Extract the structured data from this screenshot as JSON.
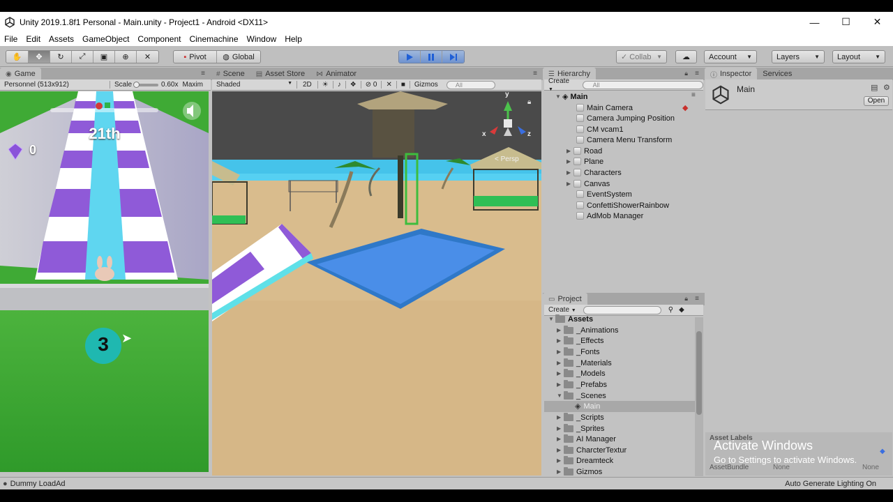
{
  "window": {
    "title": "Unity 2019.1.8f1 Personal - Main.unity - Project1 - Android <DX11>",
    "minimize": "—",
    "maximize": "☐",
    "close": "✕"
  },
  "menu": [
    "File",
    "Edit",
    "Assets",
    "GameObject",
    "Component",
    "Cinemachine",
    "Window",
    "Help"
  ],
  "toolbar": {
    "pivot": "Pivot",
    "global": "Global",
    "collab": "Collab",
    "account": "Account",
    "layers": "Layers",
    "layout": "Layout"
  },
  "game": {
    "tab": "Game",
    "resolution": "Personnel (513x912)",
    "scale_label": "Scale",
    "scale_value": "0.60x",
    "maximize": "Maxim",
    "rank": "21th",
    "gems": "0",
    "countdown": "3"
  },
  "scene": {
    "tabs": [
      "Scene",
      "Asset Store",
      "Animator"
    ],
    "shading": "Shaded",
    "mode_2d": "2D",
    "fx_count": "0",
    "gizmos": "Gizmos",
    "search_placeholder": "All",
    "persp": "< Persp",
    "axis_x": "x",
    "axis_y": "y",
    "axis_z": "z"
  },
  "hierarchy": {
    "tab": "Hierarchy",
    "create": "Create",
    "search_placeholder": "All",
    "scene": "Main",
    "items": [
      {
        "label": "Main Camera",
        "expandable": false
      },
      {
        "label": "Camera Jumping Position",
        "expandable": false
      },
      {
        "label": "CM vcam1",
        "expandable": false
      },
      {
        "label": "Camera Menu Transform",
        "expandable": false
      },
      {
        "label": "Road",
        "expandable": true
      },
      {
        "label": "Plane",
        "expandable": true
      },
      {
        "label": "Characters",
        "expandable": true
      },
      {
        "label": "Canvas",
        "expandable": true
      },
      {
        "label": "EventSystem",
        "expandable": false
      },
      {
        "label": "ConfettiShowerRainbow",
        "expandable": false
      },
      {
        "label": "AdMob Manager",
        "expandable": false
      }
    ]
  },
  "project": {
    "tab": "Project",
    "create": "Create",
    "root": "Assets",
    "items": [
      {
        "label": "_Animations",
        "type": "folder"
      },
      {
        "label": "_Effects",
        "type": "folder"
      },
      {
        "label": "_Fonts",
        "type": "folder"
      },
      {
        "label": "_Materials",
        "type": "folder"
      },
      {
        "label": "_Models",
        "type": "folder"
      },
      {
        "label": "_Prefabs",
        "type": "folder"
      },
      {
        "label": "_Scenes",
        "type": "folder-open"
      },
      {
        "label": "Main",
        "type": "scene"
      },
      {
        "label": "_Scripts",
        "type": "folder"
      },
      {
        "label": "_Sprites",
        "type": "folder"
      },
      {
        "label": "AI Manager",
        "type": "folder"
      },
      {
        "label": "CharcterTextur",
        "type": "folder"
      },
      {
        "label": "Dreamteck",
        "type": "folder"
      },
      {
        "label": "Gizmos",
        "type": "folder"
      }
    ]
  },
  "inspector": {
    "tabs": [
      "Inspector",
      "Services"
    ],
    "object_name": "Main",
    "open": "Open",
    "asset_labels": "Asset Labels",
    "asset_bundle": "AssetBundle",
    "none1": "None",
    "none2": "None"
  },
  "status": {
    "message": "Dummy LoadAd",
    "right": "Auto Generate Lighting On"
  },
  "watermark": {
    "line1": "Activate Windows",
    "line2": "Go to Settings to activate Windows."
  },
  "colors": {
    "editor_bg": "#c2c2c2",
    "toolbar_bg": "#bfbfbf",
    "play_blue": "#3a7ee0",
    "sky": "#4cc8ee",
    "sand": "#d7b98a",
    "pool": "#4a8ee8",
    "grass": "#3da632",
    "slide_purple": "#8f5ad8",
    "countdown_teal": "#1fb8b0"
  }
}
